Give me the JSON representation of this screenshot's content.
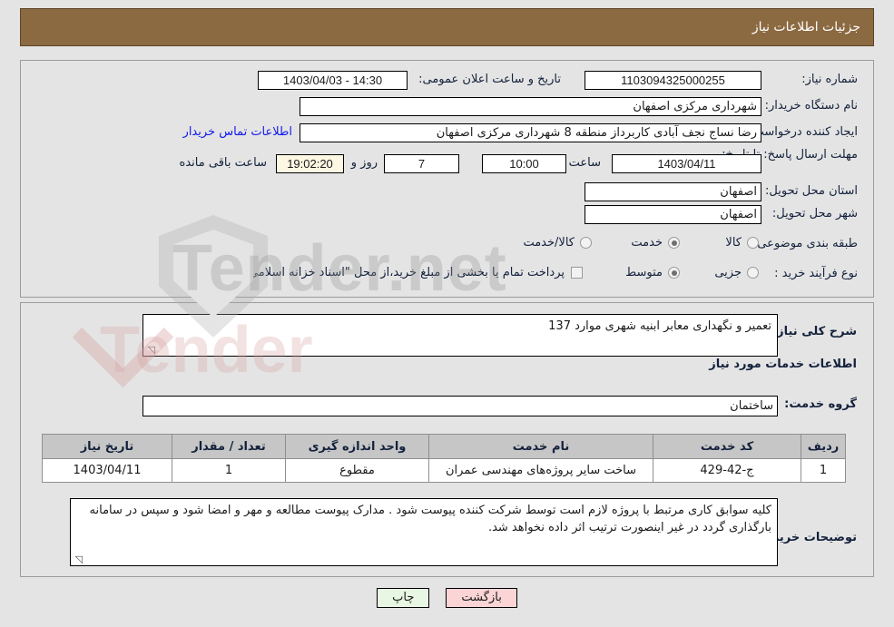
{
  "header": {
    "title": "جزئیات اطلاعات نیاز"
  },
  "top": {
    "need_number_label": "شماره نیاز:",
    "need_number_value": "1103094325000255",
    "public_announce_label": "تاریخ و ساعت اعلان عمومی:",
    "public_announce_value": "1403/04/03 - 14:30",
    "buyer_org_label": "نام دستگاه خریدار:",
    "buyer_org_value": "شهرداری مرکزی اصفهان",
    "requester_label": "ایجاد کننده درخواست:",
    "requester_value": "رضا نساج نجف آبادی کاربرداز منطقه 8 شهرداری مرکزی اصفهان",
    "buyer_contact_link": "اطلاعات تماس خریدار",
    "deadline_label": "مهلت ارسال پاسخ: تا تاریخ:",
    "deadline_date": "1403/04/11",
    "time_label": "ساعت",
    "time_value": "10:00",
    "days_value": "7",
    "days_text": "روز و",
    "countdown_value": "19:02:20",
    "remaining_text": "ساعت باقی مانده",
    "province_label": "استان محل تحویل:",
    "province_value": "اصفهان",
    "city_label": "شهر محل تحویل:",
    "city_value": "اصفهان",
    "category_label": "طبقه بندی موضوعی:",
    "category_options": [
      {
        "label": "کالا",
        "selected": false
      },
      {
        "label": "خدمت",
        "selected": true
      },
      {
        "label": "کالا/خدمت",
        "selected": false
      }
    ],
    "process_label": "نوع فرآیند خرید :",
    "process_options": [
      {
        "label": "جزیی",
        "selected": false
      },
      {
        "label": "متوسط",
        "selected": true
      }
    ],
    "treasury_checkbox_text": "پرداخت تمام یا بخشی از مبلغ خرید،از محل \"اسناد خزانه اسلامی\" خواهد بود.",
    "treasury_checked": false
  },
  "mid": {
    "summary_label": "شرح کلی نیاز:",
    "summary_value": "تعمیر و نگهداری معابر ابنیه شهری موارد 137",
    "services_heading": "اطلاعات خدمات مورد نیاز",
    "service_group_label": "گروه خدمت:",
    "service_group_value": "ساختمان",
    "table": {
      "columns": [
        "ردیف",
        "کد خدمت",
        "نام خدمت",
        "واحد اندازه گیری",
        "تعداد / مقدار",
        "تاریخ نیاز"
      ],
      "rows": [
        [
          "1",
          "ج-42-429",
          "ساخت سایر پروژه‌های مهندسی عمران",
          "مقطوع",
          "1",
          "1403/04/11"
        ]
      ]
    },
    "remarks_label": "توضیحات خریدار:",
    "remarks_value": "کلیه سوابق کاری مرتبط با پروژه لازم است توسط شرکت کننده پیوست شود . مدارک پیوست مطالعه و مهر و امضا شود و سپس در سامانه بارگذاری گردد در غیر اینصورت ترتیب اثر داده نخواهد شد."
  },
  "footer": {
    "back_label": "بازگشت",
    "print_label": "چاپ"
  },
  "colors": {
    "header_bg": "#8c6a41",
    "link": "#1019ef",
    "back_btn": "#fbd5d5",
    "print_btn": "#e8f7e3",
    "countdown_bg": "#fbf7e2"
  }
}
